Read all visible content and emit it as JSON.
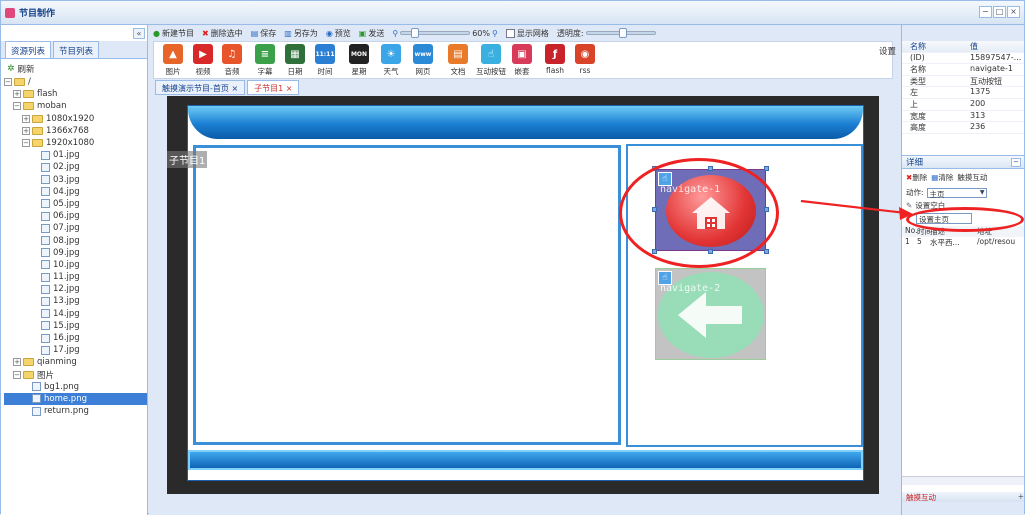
{
  "window": {
    "title": "节目制作",
    "controls": [
      "−",
      "□",
      "×"
    ]
  },
  "left_panel": {
    "tabs": [
      "资源列表",
      "节目列表"
    ],
    "refresh": "刷新",
    "tree": [
      {
        "label": "/",
        "kind": "folder",
        "level": 0,
        "toggle": "−"
      },
      {
        "label": "flash",
        "kind": "folder",
        "level": 1,
        "toggle": "+"
      },
      {
        "label": "moban",
        "kind": "folder",
        "level": 1,
        "toggle": "−"
      },
      {
        "label": "1080x1920",
        "kind": "folder",
        "level": 2,
        "toggle": "+"
      },
      {
        "label": "1366x768",
        "kind": "folder",
        "level": 2,
        "toggle": "+"
      },
      {
        "label": "1920x1080",
        "kind": "folder",
        "level": 2,
        "toggle": "−"
      },
      {
        "label": "01.jpg",
        "kind": "file",
        "level": 3
      },
      {
        "label": "02.jpg",
        "kind": "file",
        "level": 3
      },
      {
        "label": "03.jpg",
        "kind": "file",
        "level": 3
      },
      {
        "label": "04.jpg",
        "kind": "file",
        "level": 3
      },
      {
        "label": "05.jpg",
        "kind": "file",
        "level": 3
      },
      {
        "label": "06.jpg",
        "kind": "file",
        "level": 3
      },
      {
        "label": "07.jpg",
        "kind": "file",
        "level": 3
      },
      {
        "label": "08.jpg",
        "kind": "file",
        "level": 3
      },
      {
        "label": "09.jpg",
        "kind": "file",
        "level": 3
      },
      {
        "label": "10.jpg",
        "kind": "file",
        "level": 3
      },
      {
        "label": "11.jpg",
        "kind": "file",
        "level": 3
      },
      {
        "label": "12.jpg",
        "kind": "file",
        "level": 3
      },
      {
        "label": "13.jpg",
        "kind": "file",
        "level": 3
      },
      {
        "label": "14.jpg",
        "kind": "file",
        "level": 3
      },
      {
        "label": "15.jpg",
        "kind": "file",
        "level": 3
      },
      {
        "label": "16.jpg",
        "kind": "file",
        "level": 3
      },
      {
        "label": "17.jpg",
        "kind": "file",
        "level": 3
      },
      {
        "label": "qianming",
        "kind": "folder",
        "level": 1,
        "toggle": "+"
      },
      {
        "label": "图片",
        "kind": "folder",
        "level": 1,
        "toggle": "−"
      },
      {
        "label": "bg1.png",
        "kind": "file",
        "level": 2
      },
      {
        "label": "home.png",
        "kind": "file",
        "level": 2,
        "selected": true
      },
      {
        "label": "return.png",
        "kind": "file",
        "level": 2
      }
    ]
  },
  "toolbar": {
    "new": "新建节目",
    "delete": "删除选中",
    "save": "保存",
    "save_as": "另存为",
    "preview": "预览",
    "send": "发送",
    "zoom": "60%",
    "grid": "显示网格",
    "opacity": "透明度:",
    "settings": "设置"
  },
  "tools": [
    {
      "label": "图片",
      "color": "#e8652a",
      "glyph": "▲"
    },
    {
      "label": "视频",
      "color": "#d8282a",
      "glyph": "▶"
    },
    {
      "label": "音频",
      "color": "#e8552a",
      "glyph": "♫"
    },
    {
      "label": "字幕",
      "color": "#3aa04a",
      "glyph": "≡"
    },
    {
      "label": "日期",
      "color": "#2f6f3a",
      "glyph": "▦"
    },
    {
      "label": "时间",
      "color": "#2a7fd4",
      "glyph": "11:11"
    },
    {
      "label": "星期",
      "color": "#222222",
      "glyph": "MON"
    },
    {
      "label": "天气",
      "color": "#3aa6e8",
      "glyph": "☀"
    },
    {
      "label": "网页",
      "color": "#2a8ad8",
      "glyph": "www"
    },
    {
      "label": "文档",
      "color": "#e87a2a",
      "glyph": "▤"
    },
    {
      "label": "互动按钮",
      "color": "#3ab0e0",
      "glyph": "☝"
    },
    {
      "label": "嵌套",
      "color": "#d83a5a",
      "glyph": "▣"
    },
    {
      "label": "flash",
      "color": "#c8232a",
      "glyph": "ƒ"
    },
    {
      "label": "rss",
      "color": "#d8432a",
      "glyph": "◉"
    }
  ],
  "doc_tabs": [
    "触摸演示节目-首页",
    "子节目1"
  ],
  "canvas": {
    "sub_label": "子节目1",
    "nav1_label": "navigate-1",
    "nav2_label": "navigate-2"
  },
  "properties": {
    "header": [
      "名称",
      "值"
    ],
    "rows": [
      {
        "k": "(ID)",
        "v": "15897547-..."
      },
      {
        "k": "名称",
        "v": "navigate-1"
      },
      {
        "k": "类型",
        "v": "互动按钮"
      },
      {
        "k": "左",
        "v": "1375"
      },
      {
        "k": "上",
        "v": "200"
      },
      {
        "k": "宽度",
        "v": "313"
      },
      {
        "k": "高度",
        "v": "236"
      }
    ]
  },
  "detail": {
    "title": "详细",
    "delete": "删除",
    "clear": "清除",
    "touch": "触摸互动",
    "action_label": "动作:",
    "action_value": "主页",
    "set_blank": "设置空白",
    "dropdown_item": "设置主页",
    "table_header": [
      "No.",
      "时间",
      "描述",
      "地址"
    ],
    "rows": [
      {
        "no": "1",
        "time": "5",
        "desc": "水平西...",
        "addr": "/opt/resou"
      }
    ],
    "footer": "触摸互动"
  },
  "colors": {
    "accent": "#15428b",
    "highlight": "#e22222",
    "selection": "#3d7fd6"
  }
}
